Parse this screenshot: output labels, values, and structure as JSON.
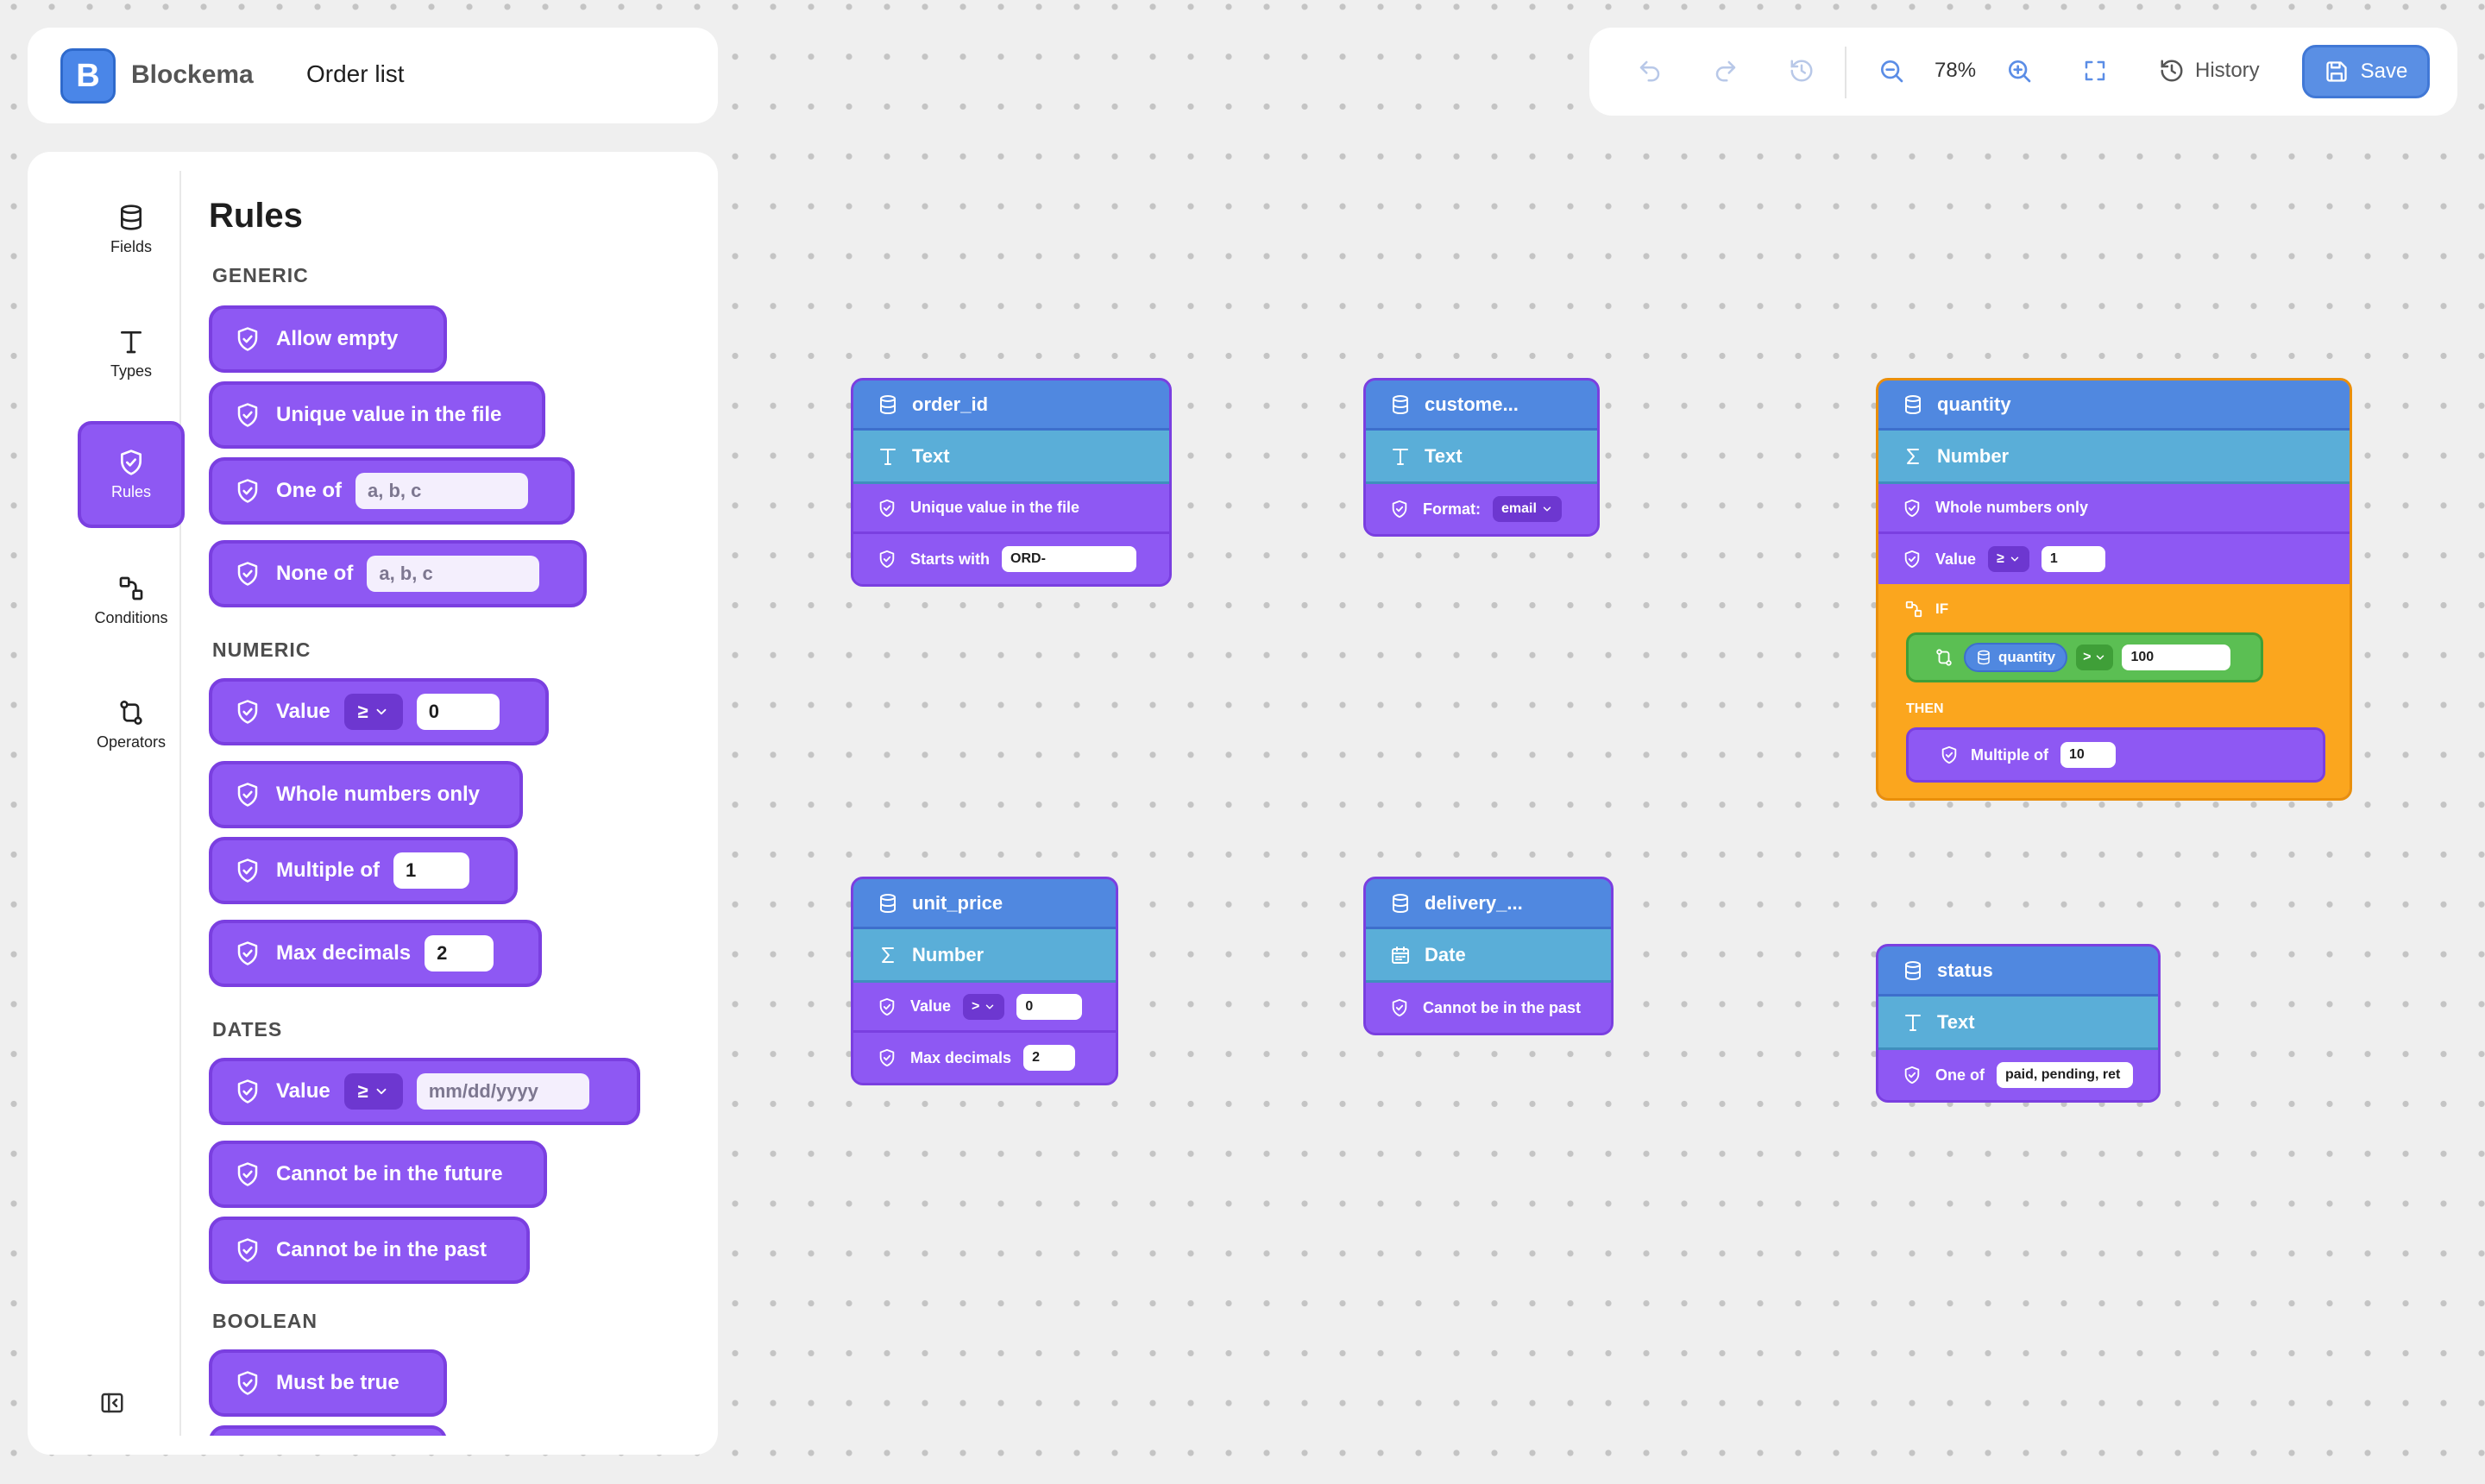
{
  "app": {
    "name": "Blockema",
    "logo_letter": "B",
    "document_title": "Order list"
  },
  "toolbar": {
    "zoom": "78%",
    "history_label": "History",
    "save_label": "Save"
  },
  "sidebar": {
    "nav": [
      {
        "label": "Fields",
        "icon": "database-icon"
      },
      {
        "label": "Types",
        "icon": "text-type-icon"
      },
      {
        "label": "Rules",
        "icon": "shield-icon",
        "active": true
      },
      {
        "label": "Conditions",
        "icon": "conditions-icon"
      },
      {
        "label": "Operators",
        "icon": "operators-icon"
      }
    ]
  },
  "rules_panel": {
    "title": "Rules",
    "sections": {
      "generic": "GENERIC",
      "numeric": "NUMERIC",
      "dates": "DATES",
      "boolean": "BOOLEAN"
    },
    "items": {
      "allow_empty": "Allow empty",
      "unique_value": "Unique value in the file",
      "one_of": "One of",
      "one_of_placeholder": "a, b, c",
      "none_of": "None of",
      "none_of_placeholder": "a, b, c",
      "value": "Value",
      "value_operator": "≥",
      "value_default": "0",
      "whole_numbers": "Whole numbers only",
      "multiple_of": "Multiple of",
      "multiple_of_default": "1",
      "max_decimals": "Max decimals",
      "max_decimals_default": "2",
      "date_value": "Value",
      "date_operator": "≥",
      "date_placeholder": "mm/dd/yyyy",
      "not_future": "Cannot be in the future",
      "not_past": "Cannot be in the past",
      "must_be_true": "Must be true"
    }
  },
  "canvas": {
    "blocks": {
      "order_id": {
        "field": "order_id",
        "type": "Text",
        "rule1": "Unique value in the file",
        "rule2": "Starts with",
        "rule2_value": "ORD-"
      },
      "customer": {
        "field": "custome...",
        "type": "Text",
        "rule1": "Format:",
        "rule1_value": "email"
      },
      "quantity": {
        "field": "quantity",
        "type": "Number",
        "rule1": "Whole numbers only",
        "rule2": "Value",
        "rule2_operator": "≥",
        "rule2_value": "1",
        "if_label": "IF",
        "cond_field": "quantity",
        "cond_operator": ">",
        "cond_value": "100",
        "then_label": "THEN",
        "then_rule": "Multiple of",
        "then_value": "10"
      },
      "unit_price": {
        "field": "unit_price",
        "type": "Number",
        "rule1": "Value",
        "rule1_operator": ">",
        "rule1_value": "0",
        "rule2": "Max decimals",
        "rule2_value": "2"
      },
      "delivery": {
        "field": "delivery_...",
        "type": "Date",
        "rule1": "Cannot be in the past"
      },
      "status": {
        "field": "status",
        "type": "Text",
        "rule1": "One of",
        "rule1_value": "paid, pending, ret"
      }
    }
  },
  "colors": {
    "accent": "#5088e0",
    "rule_purple": "#8e58f3",
    "type_blue": "#5aaed8",
    "condition_orange": "#fba61e",
    "condition_green": "#5bbf53"
  }
}
